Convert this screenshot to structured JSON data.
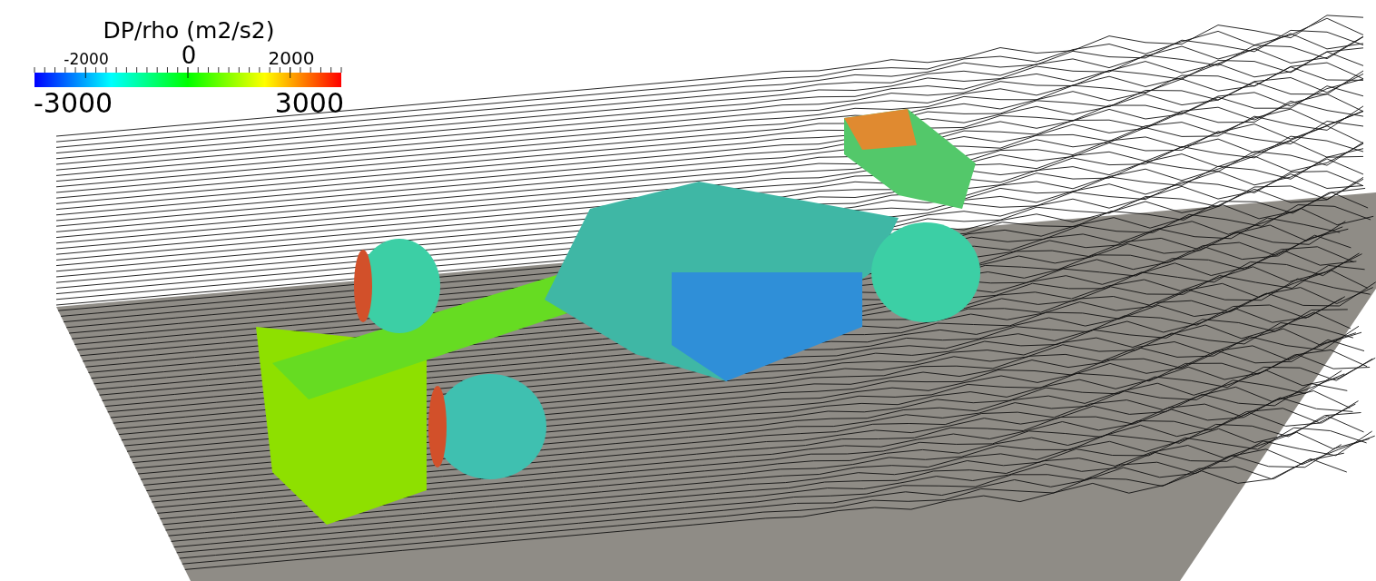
{
  "color_legend": {
    "title": "DP/rho (m2/s2)",
    "tick_labels": [
      "-2000",
      "0",
      "2000"
    ],
    "min_label": "-3000",
    "max_label": "3000"
  }
}
